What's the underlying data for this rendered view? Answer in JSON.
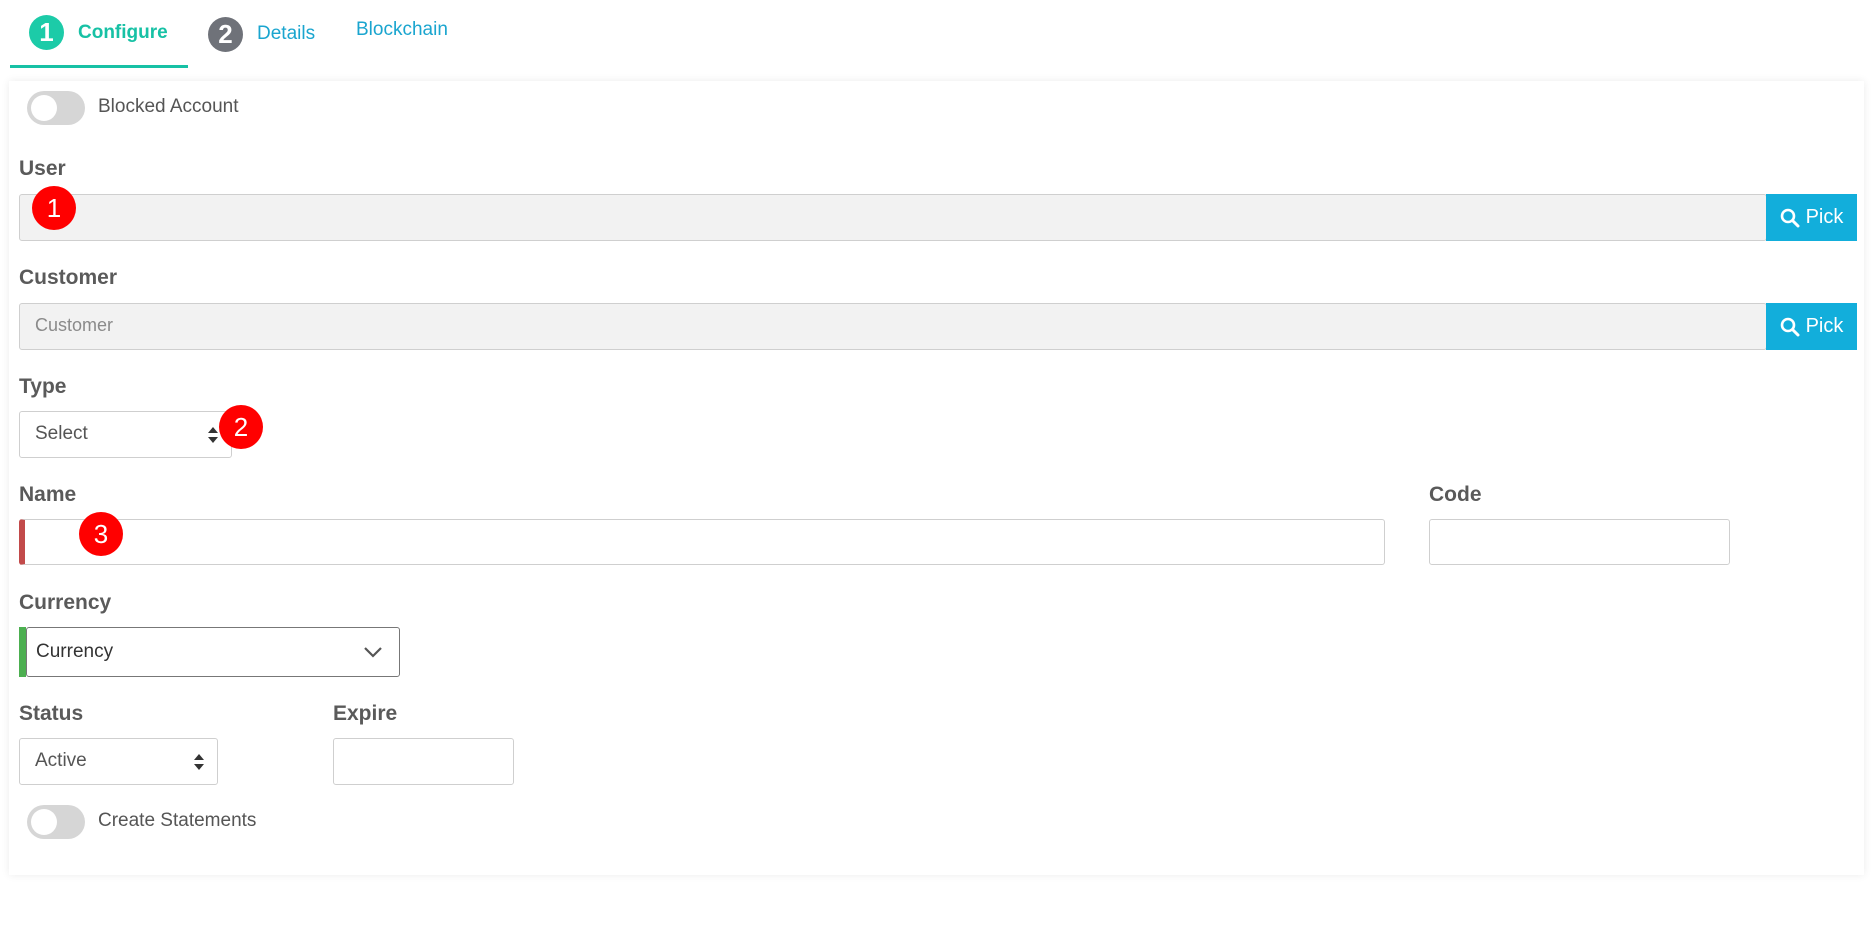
{
  "tabs": [
    {
      "number": "1",
      "label": "Configure"
    },
    {
      "number": "2",
      "label": "Details"
    },
    {
      "label": "Blockchain"
    }
  ],
  "form": {
    "blocked_account_label": "Blocked Account",
    "user_label": "User",
    "user_value": "",
    "pick_label": "Pick",
    "customer_label": "Customer",
    "customer_placeholder": "Customer",
    "type_label": "Type",
    "type_value": "Select",
    "name_label": "Name",
    "name_value": "",
    "code_label": "Code",
    "code_value": "",
    "currency_label": "Currency",
    "currency_value": "Currency",
    "status_label": "Status",
    "status_value": "Active",
    "expire_label": "Expire",
    "expire_value": "",
    "create_statements_label": "Create Statements"
  },
  "markers": [
    "1",
    "2",
    "3"
  ],
  "colors": {
    "accent_teal": "#17c1a5",
    "link_blue": "#1aa5cf",
    "pick_button": "#12aedb",
    "error_bar": "#c24a4a",
    "valid_bar": "#4caf50",
    "marker_red": "#ff0000"
  },
  "icons": {
    "pick": "search-icon",
    "select": "updown-arrows-icon",
    "dropdown": "chevron-down-icon"
  }
}
